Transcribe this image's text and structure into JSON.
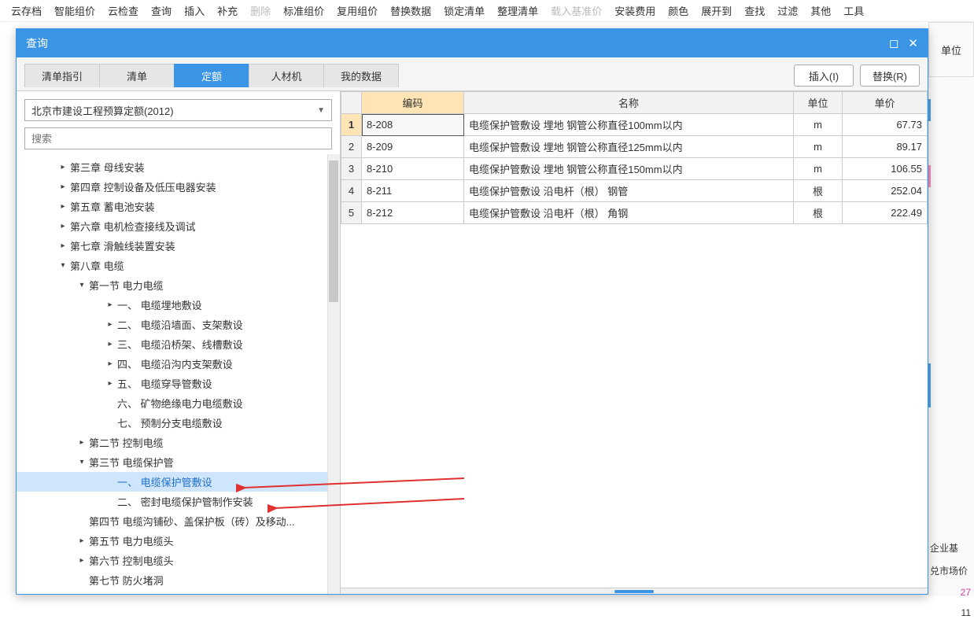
{
  "toolbar": {
    "items": [
      {
        "label": "云存档",
        "dim": false
      },
      {
        "label": "智能组价",
        "dim": false
      },
      {
        "label": "云检查",
        "dim": false
      },
      {
        "label": "查询",
        "dim": false
      },
      {
        "label": "插入",
        "dim": false
      },
      {
        "label": "补充",
        "dim": false
      },
      {
        "label": "删除",
        "dim": true
      },
      {
        "label": "标准组价",
        "dim": false
      },
      {
        "label": "复用组价",
        "dim": false
      },
      {
        "label": "替换数据",
        "dim": false
      },
      {
        "label": "锁定清单",
        "dim": false
      },
      {
        "label": "整理清单",
        "dim": false
      },
      {
        "label": "载入基准价",
        "dim": true
      },
      {
        "label": "安装费用",
        "dim": false
      },
      {
        "label": "颜色",
        "dim": false
      },
      {
        "label": "展开到",
        "dim": false
      },
      {
        "label": "查找",
        "dim": false
      },
      {
        "label": "过滤",
        "dim": false
      },
      {
        "label": "其他",
        "dim": false
      },
      {
        "label": "工具",
        "dim": false
      }
    ]
  },
  "dialog": {
    "title": "查询",
    "tabs": [
      "清单指引",
      "清单",
      "定额",
      "人材机",
      "我的数据"
    ],
    "active_tab": 2,
    "insert_btn": "插入(I)",
    "replace_btn": "替换(R)"
  },
  "combo": {
    "value": "北京市建设工程预算定额(2012)"
  },
  "search": {
    "placeholder": "搜索"
  },
  "tree": [
    {
      "depth": 1,
      "caret": "right",
      "label": "第三章 母线安装"
    },
    {
      "depth": 1,
      "caret": "right",
      "label": "第四章 控制设备及低压电器安装"
    },
    {
      "depth": 1,
      "caret": "right",
      "label": "第五章 蓄电池安装"
    },
    {
      "depth": 1,
      "caret": "right",
      "label": "第六章 电机检查接线及调试"
    },
    {
      "depth": 1,
      "caret": "right",
      "label": "第七章 滑触线装置安装"
    },
    {
      "depth": 1,
      "caret": "down",
      "label": "第八章 电缆"
    },
    {
      "depth": 2,
      "caret": "down",
      "label": "第一节 电力电缆"
    },
    {
      "depth": 3,
      "caret": "right",
      "label": "一、 电缆埋地敷设"
    },
    {
      "depth": 3,
      "caret": "right",
      "label": "二、 电缆沿墙面、支架敷设"
    },
    {
      "depth": 3,
      "caret": "right",
      "label": "三、 电缆沿桥架、线槽敷设"
    },
    {
      "depth": 3,
      "caret": "right",
      "label": "四、 电缆沿沟内支架敷设"
    },
    {
      "depth": 3,
      "caret": "right",
      "label": "五、 电缆穿导管敷设"
    },
    {
      "depth": 3,
      "caret": "none",
      "label": "六、 矿物绝缘电力电缆敷设"
    },
    {
      "depth": 3,
      "caret": "none",
      "label": "七、 预制分支电缆敷设"
    },
    {
      "depth": 2,
      "caret": "right",
      "label": "第二节 控制电缆"
    },
    {
      "depth": 2,
      "caret": "down",
      "label": "第三节 电缆保护管"
    },
    {
      "depth": 3,
      "caret": "none",
      "label": "一、 电缆保护管敷设",
      "selected": true
    },
    {
      "depth": 3,
      "caret": "none",
      "label": "二、 密封电缆保护管制作安装"
    },
    {
      "depth": 2,
      "caret": "none",
      "label": "第四节 电缆沟铺砂、盖保护板（砖）及移动..."
    },
    {
      "depth": 2,
      "caret": "right",
      "label": "第五节 电力电缆头"
    },
    {
      "depth": 2,
      "caret": "right",
      "label": "第六节 控制电缆头"
    },
    {
      "depth": 2,
      "caret": "none",
      "label": "第七节 防火堵洞"
    }
  ],
  "table": {
    "headers": {
      "row": "",
      "code": "编码",
      "name": "名称",
      "unit": "单位",
      "price": "单价"
    },
    "rows": [
      {
        "n": "1",
        "code": "8-208",
        "name": "电缆保护管敷设 埋地 钢管公称直径100mm以内",
        "unit": "m",
        "price": "67.73",
        "sel": true
      },
      {
        "n": "2",
        "code": "8-209",
        "name": "电缆保护管敷设 埋地 钢管公称直径125mm以内",
        "unit": "m",
        "price": "89.17"
      },
      {
        "n": "3",
        "code": "8-210",
        "name": "电缆保护管敷设 埋地 钢管公称直径150mm以内",
        "unit": "m",
        "price": "106.55"
      },
      {
        "n": "4",
        "code": "8-211",
        "name": "电缆保护管敷设 沿电杆（根） 钢管",
        "unit": "根",
        "price": "252.04"
      },
      {
        "n": "5",
        "code": "8-212",
        "name": "电缆保护管敷设 沿电杆（根） 角钢",
        "unit": "根",
        "price": "222.49"
      }
    ]
  },
  "bg": {
    "unit_header": "单位",
    "footer_label1": "企业基",
    "footer_label2": "兑市场价",
    "footer_v1": "27",
    "footer_v2": "11"
  }
}
